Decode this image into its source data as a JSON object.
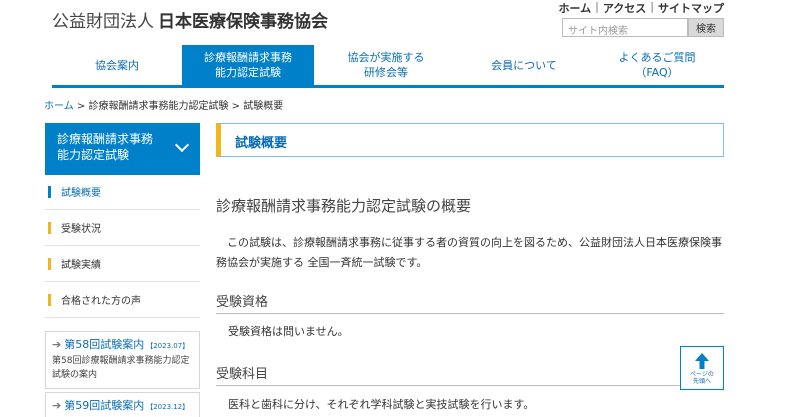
{
  "header": {
    "org_prefix": "公益財団法人",
    "org_name": "日本医療保険事務協会",
    "util_links": [
      "ホーム",
      "アクセス",
      "サイトマップ"
    ],
    "search_placeholder": "サイト内検索",
    "search_button": "検索"
  },
  "gnav": [
    {
      "label": "協会案内",
      "active": false
    },
    {
      "label": "診療報酬請求事務\n能力認定試験",
      "active": true
    },
    {
      "label": "協会が実施する\n研修会等",
      "active": false
    },
    {
      "label": "会員について",
      "active": false
    },
    {
      "label": "よくあるご質問\n（FAQ）",
      "active": false
    }
  ],
  "breadcrumb": {
    "home": "ホーム",
    "sep": " > ",
    "level2": "診療報酬請求事務能力認定試験",
    "current": "試験概要"
  },
  "sidebar": {
    "heading": "診療報酬請求事務\n能力認定試験",
    "items": [
      {
        "label": "試験概要",
        "current": true
      },
      {
        "label": "受験状況",
        "current": false
      },
      {
        "label": "試験実績",
        "current": false
      },
      {
        "label": "合格された方の声",
        "current": false
      }
    ],
    "exams": [
      {
        "title": "第58回試験案内",
        "date": "【2023.07】",
        "desc": "第58回診療報酬請求事務能力認定試験の案内"
      },
      {
        "title": "第59回試験案内",
        "date": "【2023.12】",
        "desc": ""
      }
    ]
  },
  "main": {
    "title": "試験概要",
    "section_heading": "診療報酬請求事務能力認定試験の概要",
    "intro": "この試験は、診療報酬請求事務に従事する者の資質の向上を図るため、公益財団法人日本医療保険事務協会が実施する 全国一斉統一試験です。",
    "qualification_heading": "受験資格",
    "qualification_text": "受験資格は問いません。",
    "subjects_heading": "受験科目",
    "subjects_text": "医科と歯科に分け、それぞれ学科試験と実技試験を行います。"
  },
  "pagetop": {
    "label_line1": "ページの",
    "label_line2": "先頭へ"
  }
}
